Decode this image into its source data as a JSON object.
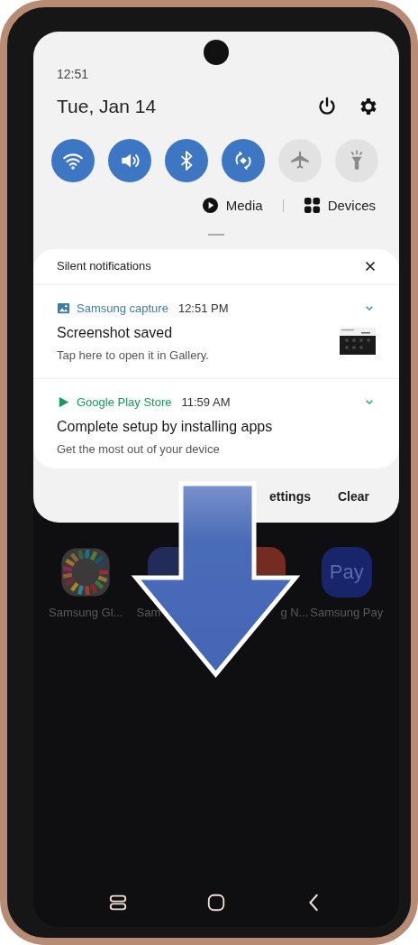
{
  "status": {
    "time": "12:51"
  },
  "header": {
    "date": "Tue, Jan 14"
  },
  "quick_toggles": [
    {
      "kind": "wifi",
      "on": true
    },
    {
      "kind": "sound",
      "on": true
    },
    {
      "kind": "bluetooth",
      "on": true
    },
    {
      "kind": "rotate",
      "on": true
    },
    {
      "kind": "airplane",
      "on": false
    },
    {
      "kind": "flashlight",
      "on": false
    }
  ],
  "shortcuts": [
    {
      "kind": "media",
      "label": "Media"
    },
    {
      "kind": "devices",
      "label": "Devices"
    }
  ],
  "notifications": {
    "title": "Silent notifications",
    "items": [
      {
        "kind": "capture",
        "app": "Samsung capture",
        "color": "#3f7d9e",
        "time": "12:51 PM",
        "title": "Screenshot saved",
        "text": "Tap here to open it in Gallery."
      },
      {
        "kind": "play",
        "app": "Google Play Store",
        "color": "#169a5c",
        "time": "11:59 AM",
        "title": "Complete setup by installing apps",
        "text": "Get the most out of your device"
      }
    ]
  },
  "footer": {
    "settings": "ettings",
    "clear": "Clear"
  },
  "apps": [
    {
      "kind": "wheel",
      "label": "Samsung Gl..."
    },
    {
      "kind": "blue",
      "label": "Sam"
    },
    {
      "kind": "red",
      "label": "g N..."
    },
    {
      "kind": "pay",
      "label": "Samsung Pay",
      "icon_text": "Pay"
    }
  ]
}
